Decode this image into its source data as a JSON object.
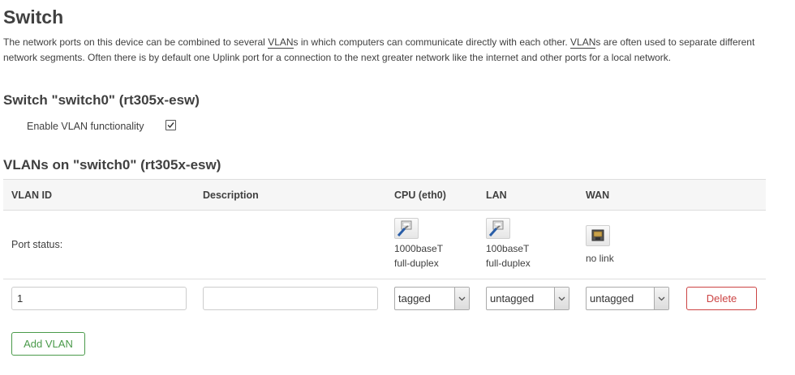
{
  "page": {
    "title": "Switch",
    "description_parts": [
      "The network ports on this device can be combined to several ",
      "VLAN",
      "s in which computers can communicate directly with each other. ",
      "VLAN",
      "s are often used to separate different network segments. Often there is by default one Uplink port for a connection to the next greater network like the internet and other ports for a local network."
    ]
  },
  "switch_section": {
    "heading": "Switch \"switch0\" (rt305x-esw)",
    "vlan_functionality_label": "Enable VLAN functionality",
    "vlan_functionality_checked": true
  },
  "vlans_section": {
    "heading": "VLANs on \"switch0\" (rt305x-esw)",
    "columns": [
      "VLAN ID",
      "Description",
      "CPU (eth0)",
      "LAN",
      "WAN"
    ],
    "port_status_label": "Port status:",
    "ports": [
      {
        "name": "CPU (eth0)",
        "icon": "ethernet-connected-icon",
        "line1": "1000baseT",
        "line2": "full-duplex"
      },
      {
        "name": "LAN",
        "icon": "ethernet-connected-icon",
        "line1": "100baseT",
        "line2": "full-duplex"
      },
      {
        "name": "WAN",
        "icon": "ethernet-disconnected-icon",
        "line1": "no link",
        "line2": ""
      }
    ],
    "vlan_rows": [
      {
        "vlan_id": "1",
        "description": "",
        "cpu": "tagged",
        "lan": "untagged",
        "wan": "untagged",
        "delete_label": "Delete"
      }
    ],
    "add_vlan_label": "Add VLAN"
  },
  "colors": {
    "delete": "#cc4444",
    "add": "#4a9a4a",
    "header_bg": "#f6f6f6",
    "link_blue": "#3a6fb0"
  }
}
